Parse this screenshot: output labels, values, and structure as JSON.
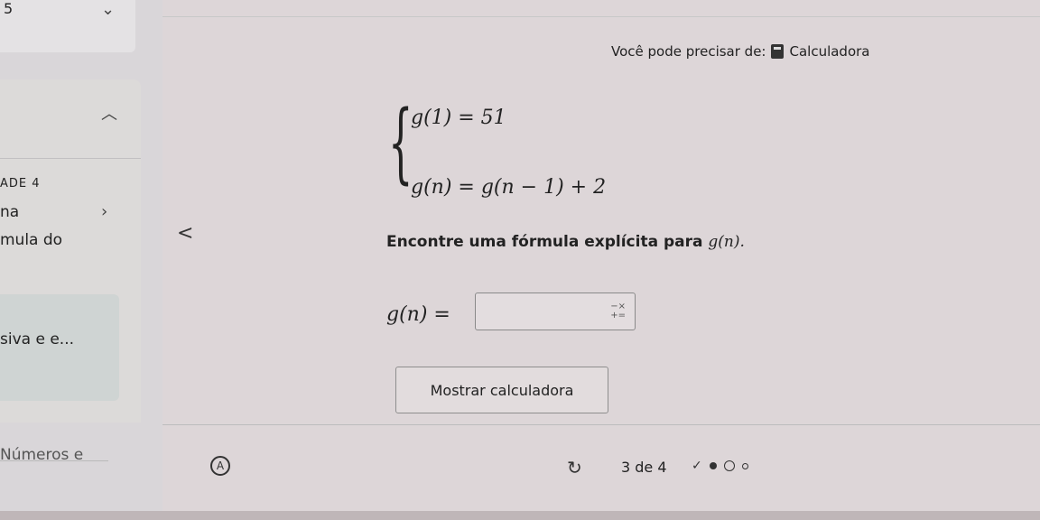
{
  "sidebar": {
    "top_label": "5",
    "section_label": "ADE 4",
    "item_na": "na",
    "item_mula": "mula do",
    "item_siva": "siva e e...",
    "item_numeros": "Números e"
  },
  "header": {
    "calc_note_prefix": "Você pode precisar de:",
    "calc_note_link": "Calculadora"
  },
  "problem": {
    "equation_1": "g(1) = 51",
    "equation_2": "g(n) = g(n − 1) + 2",
    "question_text": "Encontre uma fórmula explícita para ",
    "question_math": "g(n).",
    "answer_label": "g(n) =",
    "answer_value": ""
  },
  "buttons": {
    "show_calculator": "Mostrar calculadora"
  },
  "footer": {
    "progress_text": "3 de 4"
  },
  "icons": {
    "calculator": "calculator-icon",
    "accessibility": "accessibility-icon",
    "retry": "retry-icon",
    "ops": "operations-icon"
  }
}
